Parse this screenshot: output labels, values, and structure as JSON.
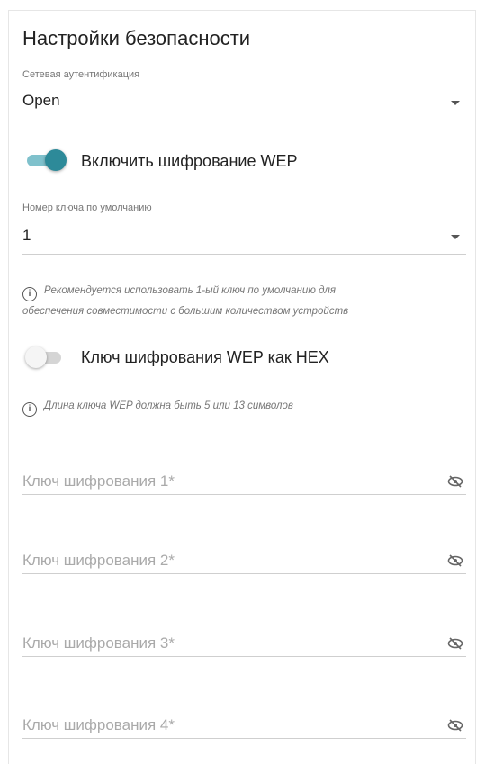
{
  "title": "Настройки безопасности",
  "auth": {
    "label": "Сетевая аутентификация",
    "value": "Open"
  },
  "wep_toggle": {
    "label": "Включить шифрование WEP",
    "state": "on"
  },
  "default_key": {
    "label": "Номер ключа по умолчанию",
    "value": "1"
  },
  "hint1_line1": "Рекомендуется использовать 1-ый ключ по умолчанию для",
  "hint1_line2": "обеспечения совместимости с большим количеством устройств",
  "hex_toggle": {
    "label": "Ключ шифрования WEP как HEX",
    "state": "off"
  },
  "hint2": "Длина ключа WEP должна быть 5 или 13 символов",
  "keys": [
    {
      "placeholder": "Ключ шифрования 1*"
    },
    {
      "placeholder": "Ключ шифрования 2*"
    },
    {
      "placeholder": "Ключ шифрования 3*"
    },
    {
      "placeholder": "Ключ шифрования 4*"
    }
  ],
  "colors": {
    "toggle_on": "#2d8a99",
    "toggle_track_on": "#7fc1cc",
    "toggle_off": "#d5d5d5"
  },
  "icons": {
    "info": "info-icon",
    "dropdown": "chevron-down-icon",
    "eye": "eye-off-icon"
  }
}
